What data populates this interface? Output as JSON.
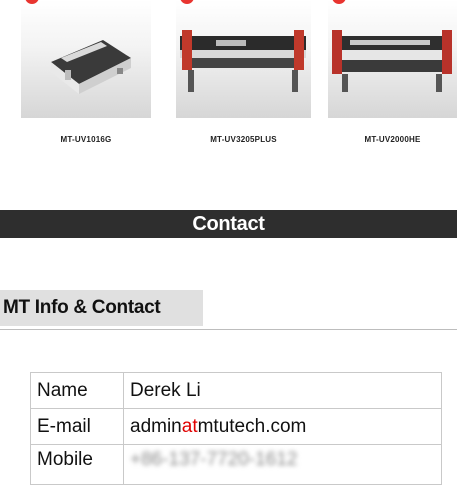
{
  "products": [
    {
      "name": "MT-UV1016G",
      "image": "flatbed-uv-printer"
    },
    {
      "name": "MT-UV3205PLUS",
      "image": "wide-roll-uv-printer"
    },
    {
      "name": "MT-UV2000HE",
      "image": "hybrid-uv-printer"
    }
  ],
  "contact_bar": {
    "title": "Contact"
  },
  "info": {
    "heading": "MT Info & Contact",
    "rows": {
      "name": {
        "label": "Name",
        "value": "Derek Li"
      },
      "email": {
        "label": "E-mail",
        "user": "admin",
        "at": "at",
        "domain": "mtutech.com"
      },
      "mobile": {
        "label": "Mobile",
        "value": "+86-137-7720-1612"
      }
    }
  },
  "colors": {
    "contact_bar_bg": "#2e2e2e",
    "heading_bg": "#e0e0e0",
    "email_at": "#e00000",
    "hot_badge": "#e8342f"
  }
}
